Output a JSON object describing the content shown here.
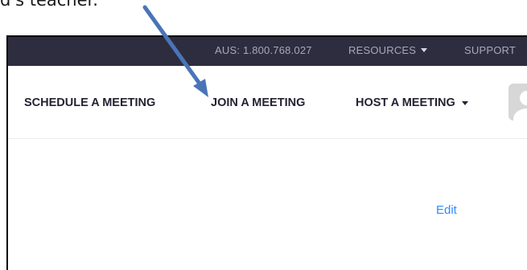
{
  "caption": {
    "text": "d's teacher."
  },
  "topbar": {
    "phone": "AUS: 1.800.768.027",
    "resources_label": "RESOURCES",
    "support_label": "SUPPORT"
  },
  "nav": {
    "schedule_label": "SCHEDULE A MEETING",
    "join_label": "JOIN A MEETING",
    "host_label": "HOST A MEETING"
  },
  "content": {
    "edit_label": "Edit"
  },
  "colors": {
    "topbar_bg": "#2d2d3f",
    "topbar_text": "#a8a8bc",
    "nav_text": "#232333",
    "link_blue": "#2d8cff",
    "arrow": "#4a74b8"
  },
  "icons": {
    "resources_caret": "chevron-down-icon",
    "host_caret": "chevron-down-icon",
    "avatar": "user-avatar-icon",
    "annotation": "arrow-annotation-icon"
  }
}
